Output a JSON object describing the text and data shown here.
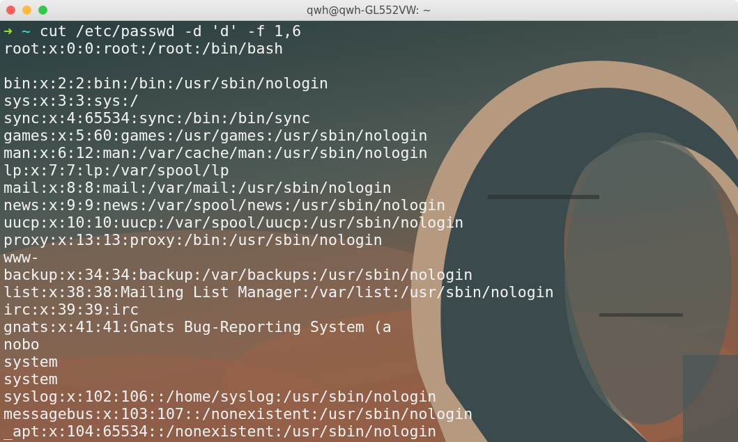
{
  "window": {
    "title": "qwh@qwh-GL552VW: ~",
    "controls": [
      {
        "color": "#fc605c"
      },
      {
        "color": "#fdbc40"
      },
      {
        "color": "#34c84a"
      }
    ]
  },
  "terminal": {
    "prompt": {
      "arrow": "➜",
      "cwd": "~",
      "command": "cut /etc/passwd -d 'd' -f 1,6"
    },
    "lines": [
      {
        "kind": "text",
        "text": "root:x:0:0:root:/root:/bin/bash"
      },
      {
        "kind": "blank"
      },
      {
        "kind": "text",
        "text": "bin:x:2:2:bin:/bin:/usr/sbin/nologin"
      },
      {
        "kind": "text",
        "text": "sys:x:3:3:sys:/"
      },
      {
        "kind": "text",
        "text": "sync:x:4:65534:sync:/bin:/bin/sync"
      },
      {
        "kind": "text",
        "text": "games:x:5:60:games:/usr/games:/usr/sbin/nologin"
      },
      {
        "kind": "text",
        "text": "man:x:6:12:man:/var/cache/man:/usr/sbin/nologin"
      },
      {
        "kind": "text",
        "text": "lp:x:7:7:lp:/var/spool/lp"
      },
      {
        "kind": "text",
        "text": "mail:x:8:8:mail:/var/mail:/usr/sbin/nologin"
      },
      {
        "kind": "text",
        "text": "news:x:9:9:news:/var/spool/news:/usr/sbin/nologin"
      },
      {
        "kind": "text",
        "text": "uucp:x:10:10:uucp:/var/spool/uucp:/usr/sbin/nologin"
      },
      {
        "kind": "text",
        "text": "proxy:x:13:13:proxy:/bin:/usr/sbin/nologin"
      },
      {
        "kind": "text",
        "text": "www-"
      },
      {
        "kind": "text",
        "text": "backup:x:34:34:backup:/var/backups:/usr/sbin/nologin"
      },
      {
        "kind": "text",
        "text": "list:x:38:38:Mailing List Manager:/var/list:/usr/sbin/nologin"
      },
      {
        "kind": "text",
        "text": "irc:x:39:39:irc"
      },
      {
        "kind": "text",
        "text": "gnats:x:41:41:Gnats Bug-Reporting System (a"
      },
      {
        "kind": "text",
        "text": "nobo"
      },
      {
        "kind": "text",
        "text": "system"
      },
      {
        "kind": "text",
        "text": "system"
      },
      {
        "kind": "text",
        "text": "syslog:x:102:106::/home/syslog:/usr/sbin/nologin"
      },
      {
        "kind": "text",
        "text": "messagebus:x:103:107::/nonexistent:/usr/sbin/nologin"
      },
      {
        "kind": "text",
        "text": "_apt:x:104:65534::/nonexistent:/usr/sbin/nologin"
      }
    ]
  }
}
